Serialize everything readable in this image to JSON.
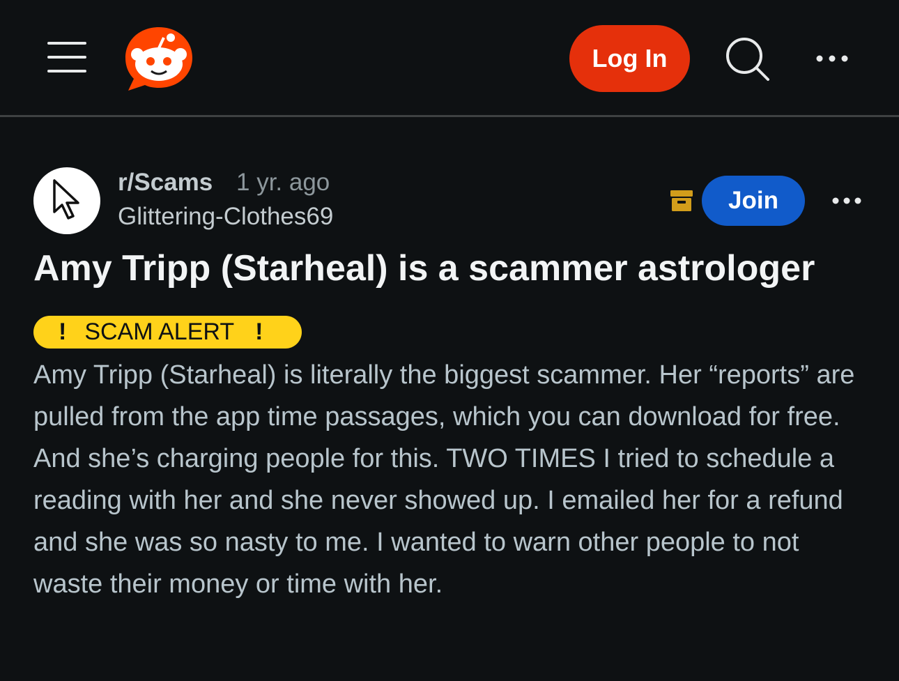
{
  "header": {
    "login_label": "Log In"
  },
  "post": {
    "subreddit": "r/Scams",
    "time_ago": "1 yr. ago",
    "author": "Glittering-Clothes69",
    "join_label": "Join",
    "title": "Amy Tripp (Starheal) is a scammer astrologer",
    "flair": {
      "left_mark": "!",
      "text": "SCAM ALERT",
      "right_mark": "!"
    },
    "body": "Amy Tripp (Starheal) is literally the biggest scammer. Her “reports” are pulled from the app time passages, which you can download for free. And she’s charging people for this. TWO TIMES I tried to schedule a reading with her and she never showed up. I emailed her for a refund and she was so nasty to me. I wanted to warn other people to not waste their money or time with her."
  },
  "icons": {
    "menu": "hamburger-menu-icon",
    "logo": "reddit-logo-icon",
    "search": "search-icon",
    "more": "more-options-icon",
    "avatar": "cursor-arrow-icon",
    "archived": "archive-box-icon"
  },
  "colors": {
    "background": "#0e1113",
    "login": "#e5300b",
    "join": "#115bca",
    "flair": "#ffd21a",
    "archive": "#d29d1b"
  }
}
